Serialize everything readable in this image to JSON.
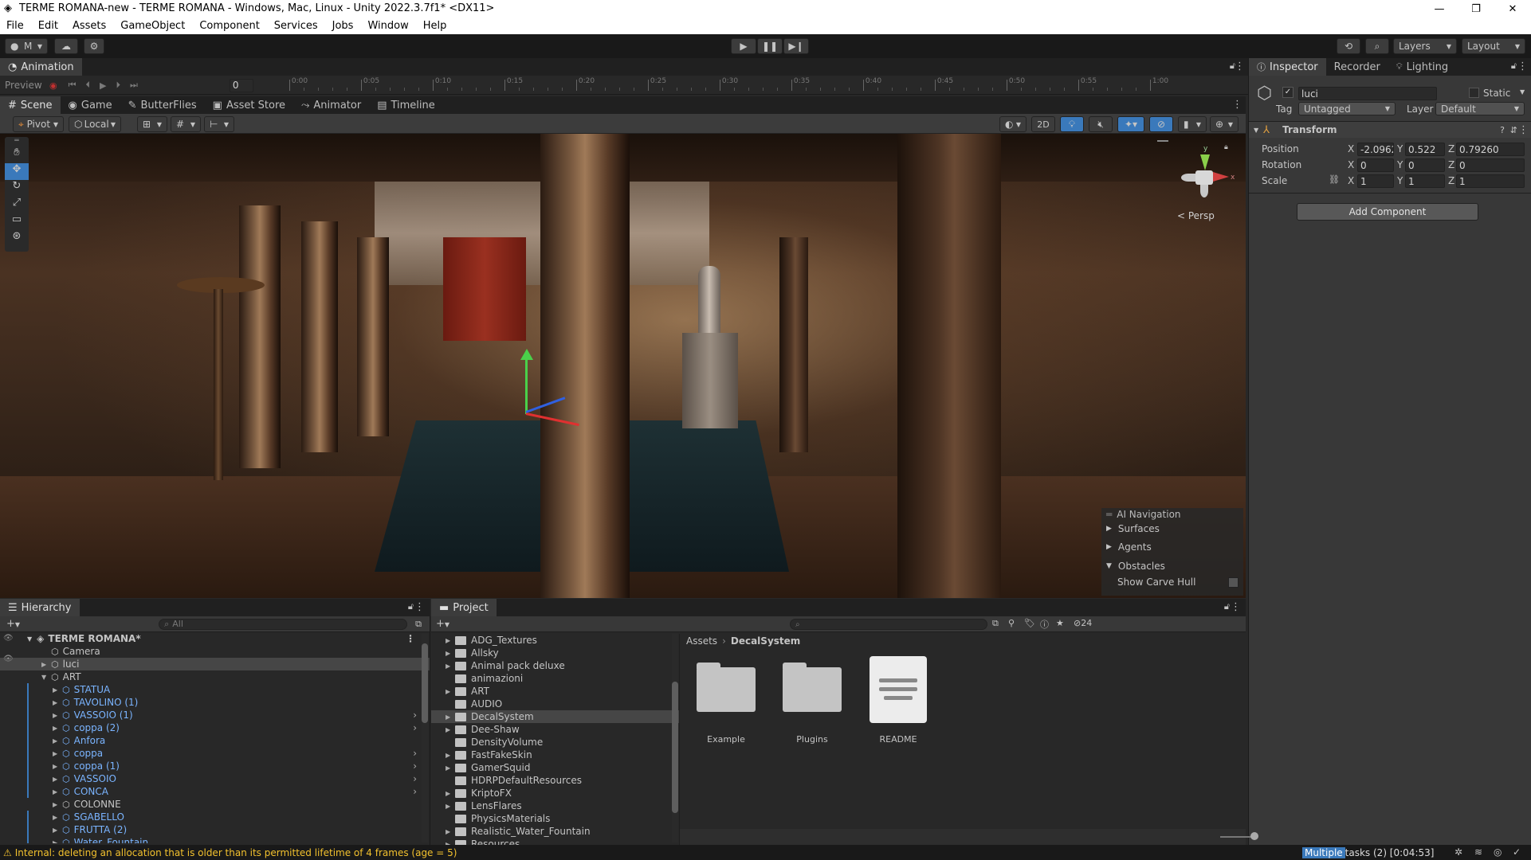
{
  "window": {
    "title": "TERME ROMANA-new - TERME ROMANA - Windows, Mac, Linux - Unity 2022.3.7f1* <DX11>",
    "minimize": "—",
    "maximize": "❐",
    "close": "✕"
  },
  "menu": [
    "File",
    "Edit",
    "Assets",
    "GameObject",
    "Component",
    "Services",
    "Jobs",
    "Window",
    "Help"
  ],
  "toolbar": {
    "account": "M",
    "layers": "Layers",
    "layout": "Layout"
  },
  "animation": {
    "tab": "Animation",
    "preview": "Preview",
    "frame": "0",
    "ticks": [
      "0:00",
      "0:05",
      "0:10",
      "0:15",
      "0:20",
      "0:25",
      "0:30",
      "0:35",
      "0:40",
      "0:45",
      "0:50",
      "0:55",
      "1:00"
    ]
  },
  "scene_tabs": [
    {
      "label": "Scene",
      "icon": "#"
    },
    {
      "label": "Game",
      "icon": "◉"
    },
    {
      "label": "ButterFlies",
      "icon": "✎"
    },
    {
      "label": "Asset Store",
      "icon": "▣"
    },
    {
      "label": "Animator",
      "icon": "⤳"
    },
    {
      "label": "Timeline",
      "icon": "▤"
    }
  ],
  "scene_tools": {
    "pivot": "Pivot",
    "local": "Local",
    "mode2d": "2D",
    "persp": "< Persp"
  },
  "ai_navigation": {
    "title": "AI Navigation",
    "items": [
      "Surfaces",
      "Agents",
      "Obstacles"
    ],
    "show_carve_hull": "Show Carve Hull"
  },
  "inspector": {
    "tabs": [
      "Inspector",
      "Recorder",
      "Lighting"
    ],
    "object_name": "luci",
    "static_label": "Static",
    "tag_label": "Tag",
    "tag_value": "Untagged",
    "layer_label": "Layer",
    "layer_value": "Default",
    "transform_title": "Transform",
    "position_label": "Position",
    "rotation_label": "Rotation",
    "scale_label": "Scale",
    "position": {
      "x": "-2.0962",
      "y": "0.522",
      "z": "0.79260"
    },
    "rotation": {
      "x": "0",
      "y": "0",
      "z": "0"
    },
    "scale": {
      "x": "1",
      "y": "1",
      "z": "1"
    },
    "add_component": "Add Component"
  },
  "hierarchy": {
    "tab": "Hierarchy",
    "search_placeholder": "All",
    "root": "TERME ROMANA*",
    "items": [
      {
        "label": "Camera",
        "indent": 1,
        "prefab": false,
        "arrow": false
      },
      {
        "label": "luci",
        "indent": 1,
        "prefab": false,
        "arrow": true,
        "selected": true
      },
      {
        "label": "ART",
        "indent": 1,
        "prefab": false,
        "arrow": true,
        "open": true
      },
      {
        "label": "STATUA",
        "indent": 2,
        "prefab": true,
        "arrow": true
      },
      {
        "label": "TAVOLINO (1)",
        "indent": 2,
        "prefab": true,
        "arrow": true
      },
      {
        "label": "VASSOIO (1)",
        "indent": 2,
        "prefab": true,
        "arrow": true,
        "more": true
      },
      {
        "label": "coppa (2)",
        "indent": 2,
        "prefab": true,
        "arrow": true,
        "more": true
      },
      {
        "label": "Anfora",
        "indent": 2,
        "prefab": true,
        "arrow": true
      },
      {
        "label": "coppa",
        "indent": 2,
        "prefab": true,
        "arrow": true,
        "more": true
      },
      {
        "label": "coppa (1)",
        "indent": 2,
        "prefab": true,
        "arrow": true,
        "more": true
      },
      {
        "label": "VASSOIO",
        "indent": 2,
        "prefab": true,
        "arrow": true,
        "more": true
      },
      {
        "label": "CONCA",
        "indent": 2,
        "prefab": true,
        "arrow": true,
        "more": true
      },
      {
        "label": "COLONNE",
        "indent": 2,
        "prefab": false,
        "arrow": true
      },
      {
        "label": "SGABELLO",
        "indent": 2,
        "prefab": true,
        "arrow": true
      },
      {
        "label": "FRUTTA (2)",
        "indent": 2,
        "prefab": true,
        "arrow": true
      },
      {
        "label": "Water_Fountain",
        "indent": 2,
        "prefab": true,
        "arrow": true
      }
    ]
  },
  "project": {
    "tab": "Project",
    "hidden_count": "24",
    "breadcrumb_root": "Assets",
    "breadcrumb_current": "DecalSystem",
    "folders": [
      {
        "label": "ADG_Textures",
        "arrow": true
      },
      {
        "label": "Allsky",
        "arrow": true
      },
      {
        "label": "Animal pack deluxe",
        "arrow": true
      },
      {
        "label": "animazioni",
        "arrow": false
      },
      {
        "label": "ART",
        "arrow": true
      },
      {
        "label": "AUDIO",
        "arrow": false
      },
      {
        "label": "DecalSystem",
        "arrow": true,
        "selected": true
      },
      {
        "label": "Dee-Shaw",
        "arrow": true
      },
      {
        "label": "DensityVolume",
        "arrow": false
      },
      {
        "label": "FastFakeSkin",
        "arrow": true
      },
      {
        "label": "GamerSquid",
        "arrow": true
      },
      {
        "label": "HDRPDefaultResources",
        "arrow": false
      },
      {
        "label": "KriptoFX",
        "arrow": true
      },
      {
        "label": "LensFlares",
        "arrow": true
      },
      {
        "label": "PhysicsMaterials",
        "arrow": false
      },
      {
        "label": "Realistic_Water_Fountain",
        "arrow": true
      },
      {
        "label": "Resources",
        "arrow": true
      }
    ],
    "assets": [
      {
        "label": "Example",
        "kind": "folder"
      },
      {
        "label": "Plugins",
        "kind": "folder"
      },
      {
        "label": "README",
        "kind": "doc"
      }
    ]
  },
  "status": {
    "message": "Internal: deleting an allocation that is older than its permitted lifetime of 4 frames (age = 5)",
    "tasks_highlight": "Multiple",
    "tasks": " tasks (2) [0:04:53]"
  },
  "colors": {
    "accent": "#3a79bb",
    "prefab": "#7ab4ff",
    "warning": "#f2c12e"
  }
}
